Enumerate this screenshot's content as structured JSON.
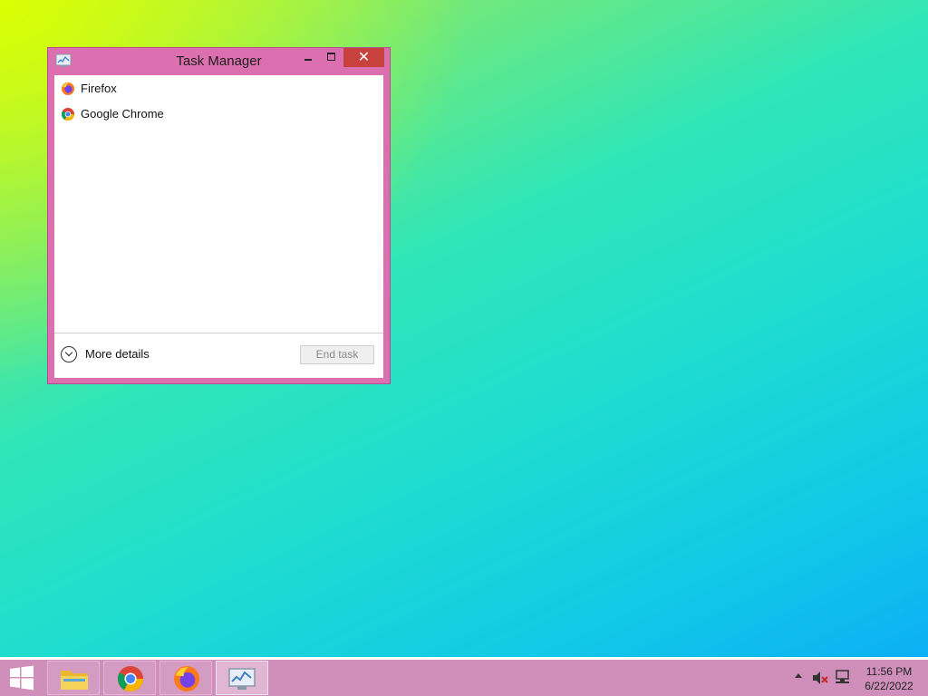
{
  "window": {
    "title": "Task Manager",
    "close_glyph": "✕",
    "icon": "task-manager-icon"
  },
  "apps": [
    {
      "label": "Firefox",
      "icon": "firefox-icon"
    },
    {
      "label": "Google Chrome",
      "icon": "chrome-icon"
    }
  ],
  "footer": {
    "more_details_label": "More details",
    "end_task_label": "End task"
  },
  "taskbar": {
    "items": [
      {
        "name": "file-explorer",
        "icon": "folder-icon"
      },
      {
        "name": "google-chrome",
        "icon": "chrome-icon"
      },
      {
        "name": "firefox",
        "icon": "firefox-icon"
      },
      {
        "name": "task-manager",
        "icon": "task-manager-icon",
        "active": true
      }
    ],
    "clock": {
      "time": "11:56 PM",
      "date": "6/22/2022"
    }
  },
  "colors": {
    "window_frame": "#dc6fb0",
    "close_button": "#c7413d",
    "taskbar": "#cf8fba"
  }
}
